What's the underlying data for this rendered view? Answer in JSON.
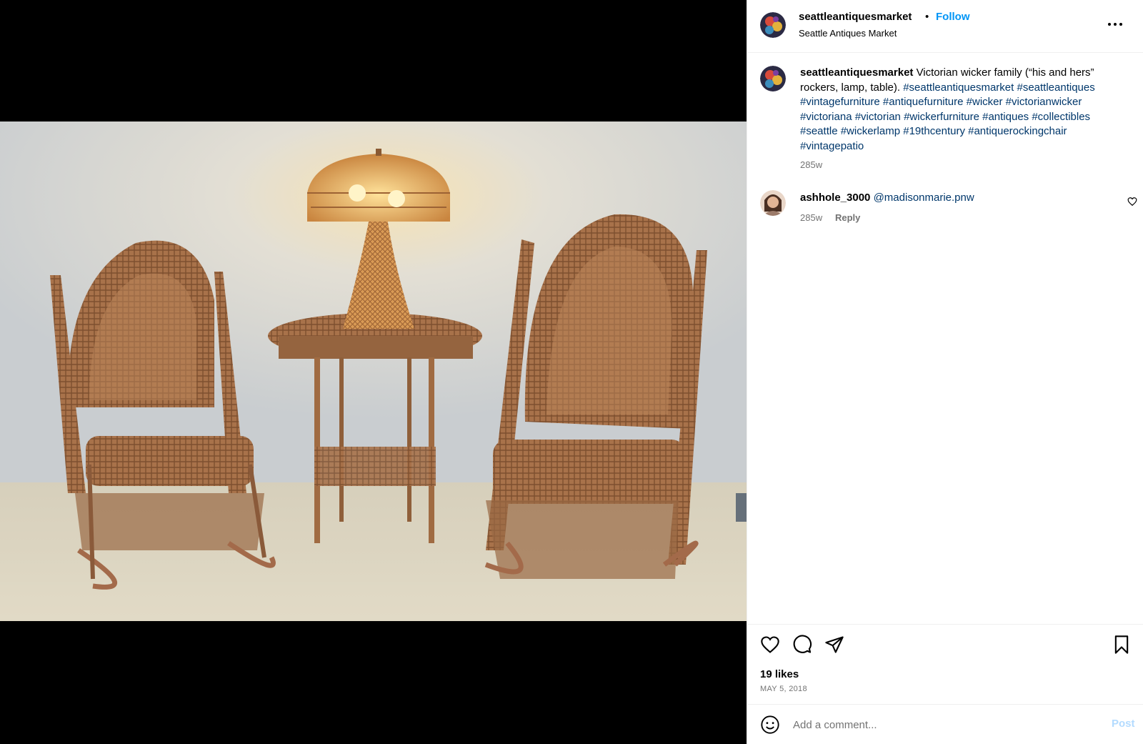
{
  "post": {
    "username": "seattleantiquesmarket",
    "dot": "•",
    "follow_label": "Follow",
    "location": "Seattle Antiques Market"
  },
  "caption": {
    "username": "seattleantiquesmarket",
    "text": "Victorian wicker family (“his and hers” rockers, lamp, table).",
    "hashtags": "#seattleantiquesmarket #seattleantiques #vintagefurniture #antiquefurniture #wicker #victorianwicker #victoriana #victorian #wickerfurniture #antiques #collectibles #seattle #wickerlamp #19thcentury #antiquerockingchair #vintagepatio",
    "time": "285w"
  },
  "comments": [
    {
      "username": "ashhole_3000",
      "mention": "@madisonmarie.pnw",
      "time": "285w",
      "reply_label": "Reply"
    }
  ],
  "stats": {
    "likes": "19 likes",
    "date": "MAY 5, 2018"
  },
  "composer": {
    "placeholder": "Add a comment...",
    "post_label": "Post"
  },
  "icons": {
    "like": "heart-icon",
    "comment": "comment-icon",
    "share": "share-icon",
    "save": "bookmark-icon",
    "more": "more-options-icon",
    "emoji": "emoji-icon"
  },
  "colors": {
    "follow": "#0095f6",
    "hashtag": "#00376b",
    "muted": "#737373",
    "post_disabled": "#b3dbff"
  }
}
